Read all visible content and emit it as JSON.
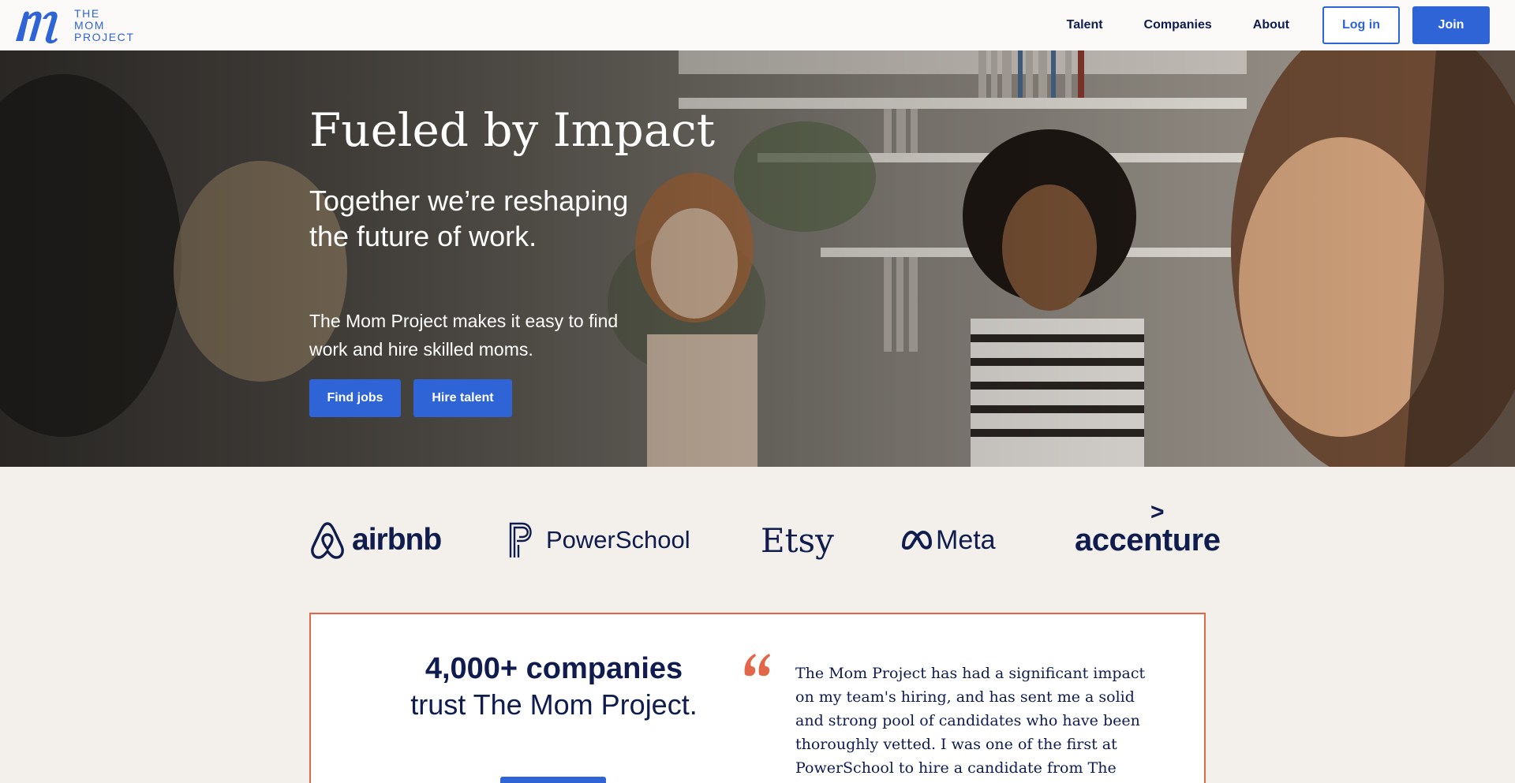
{
  "brand": {
    "logo_line1": "THE",
    "logo_line2": "MOM",
    "logo_line3": "PROJECT",
    "accent_color": "#2f64d6",
    "card_border_color": "#e2674a"
  },
  "nav": {
    "items": [
      {
        "label": "Talent"
      },
      {
        "label": "Companies"
      },
      {
        "label": "About"
      }
    ],
    "login_label": "Log in",
    "join_label": "Join"
  },
  "hero": {
    "title": "Fueled by Impact",
    "subtitle": "Together we’re reshaping the future of work.",
    "body": "The Mom Project makes it easy to find work and hire skilled moms.",
    "find_jobs_label": "Find jobs",
    "hire_talent_label": "Hire talent"
  },
  "partners": {
    "airbnb": "airbnb",
    "powerschool": "PowerSchool",
    "etsy": "Etsy",
    "meta": "Meta",
    "accenture": "accenture"
  },
  "testimonial": {
    "stat": "4,000+ companies",
    "trust_line": "trust The Mom Project.",
    "quote": "The Mom Project has had a significant impact on my team's hiring, and has sent me a solid and strong pool of candidates who have been thoroughly vetted. I was one of the first at PowerSchool to hire a candidate from The Mom Project, and have come"
  }
}
